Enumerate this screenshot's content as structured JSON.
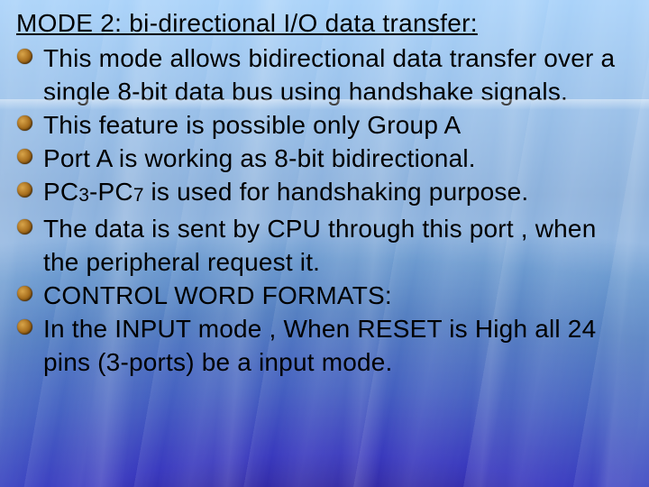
{
  "slide": {
    "heading": "MODE 2: bi-directional I/O data transfer:",
    "bullets": [
      {
        "html": "This mode allows bidirectional data transfer over a single 8-bit data bus using handshake signals."
      },
      {
        "html": "This feature is possible only Group A"
      },
      {
        "html": "Port A  is working as 8-bit bidirectional."
      },
      {
        "html": "PC<span class=\"sub\">3</span>-PC<span class=\"sub\">7</span> is used for handshaking purpose."
      },
      {
        "html": "The data is sent by CPU through this port , when the peripheral request it."
      },
      {
        "html": "CONTROL WORD FORMATS:"
      },
      {
        "html": "In the INPUT mode , When RESET  is High all 24 pins (3-ports) be a input mode."
      }
    ]
  }
}
